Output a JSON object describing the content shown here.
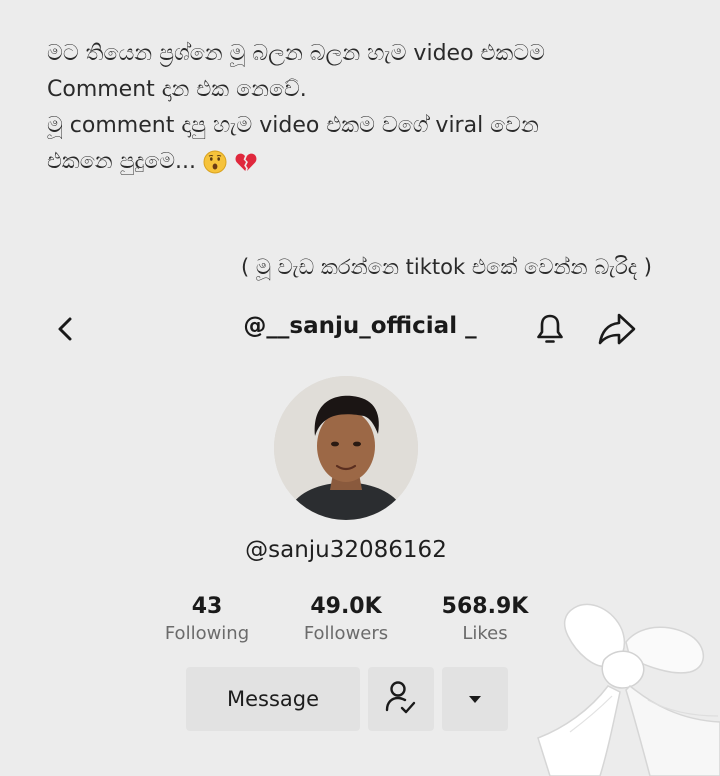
{
  "caption": {
    "line1": "මට තියෙන ප්‍රශ්නෙ මූ බලන බලන හැම video එකටම",
    "line2": "Comment දාන එක නෙවේ.",
    "line3": "මූ comment දාපු හැම video එකම වගේ viral වෙන",
    "line4": "එකනෙ පුදුමෙ...",
    "emoji1": "astonished-face",
    "emoji2": "broken-heart"
  },
  "note": "( මූ වැඩ කරන්නෙ tiktok එකේ වෙන්න බැරිද )",
  "topbar": {
    "handle": "@__sanju_official _",
    "icons": [
      "chevron-left-icon",
      "bell-icon",
      "share-arrow-icon"
    ]
  },
  "profile": {
    "username": "@sanju32086162",
    "stats": [
      {
        "value": "43",
        "label": "Following"
      },
      {
        "value": "49.0K",
        "label": "Followers"
      },
      {
        "value": "568.9K",
        "label": "Likes"
      }
    ]
  },
  "actions": {
    "message_label": "Message",
    "friend_icon": "person-check-icon",
    "more_icon": "caret-down-icon"
  },
  "colors": {
    "background": "#ececec",
    "button": "#e2e2e2",
    "text": "#1f1f1f",
    "muted": "#6b6b6b"
  }
}
